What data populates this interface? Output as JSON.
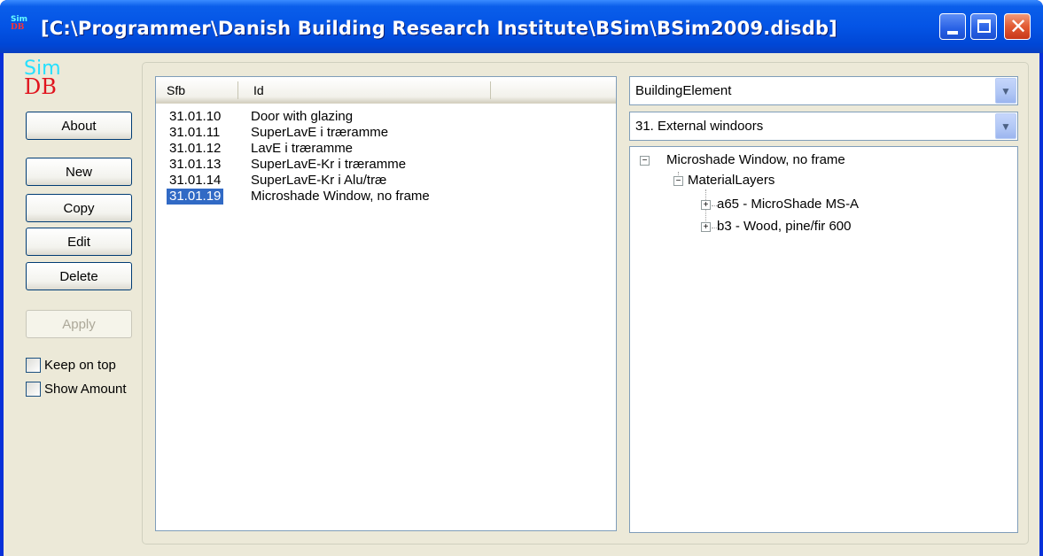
{
  "window": {
    "title": "[C:\\Programmer\\Danish Building Research Institute\\BSim\\BSim2009.disdb]",
    "icon_top": "Sim",
    "icon_bottom": "DB"
  },
  "logo": {
    "sim": "Sim",
    "db": "DB"
  },
  "buttons": {
    "about": "About",
    "new": "New",
    "copy": "Copy",
    "edit": "Edit",
    "delete": "Delete",
    "apply": "Apply"
  },
  "checkboxes": {
    "keep_on_top": {
      "label": "Keep on top",
      "checked": false
    },
    "show_amount": {
      "label": "Show Amount",
      "checked": false
    }
  },
  "list": {
    "columns": [
      "Sfb",
      "Id"
    ],
    "rows": [
      {
        "sfb": "31.01.10",
        "id": "Door with glazing",
        "selected": false
      },
      {
        "sfb": "31.01.11",
        "id": "SuperLavE i træramme",
        "selected": false
      },
      {
        "sfb": "31.01.12",
        "id": "LavE i træramme",
        "selected": false
      },
      {
        "sfb": "31.01.13",
        "id": "SuperLavE-Kr i træramme",
        "selected": false
      },
      {
        "sfb": "31.01.14",
        "id": "SuperLavE-Kr i Alu/træ",
        "selected": false
      },
      {
        "sfb": "31.01.19",
        "id": "Microshade Window, no frame",
        "selected": true
      }
    ]
  },
  "combos": {
    "type": "BuildingElement",
    "category": "31. External windoors"
  },
  "tree": {
    "root": "Microshade Window, no frame",
    "child": "MaterialLayers",
    "leaves": [
      "a65 - MicroShade MS-A",
      "b3 - Wood, pine/fir 600"
    ]
  },
  "colors": {
    "titlebar": "#0454e5",
    "face": "#ece9d8",
    "selection": "#316ac5"
  }
}
